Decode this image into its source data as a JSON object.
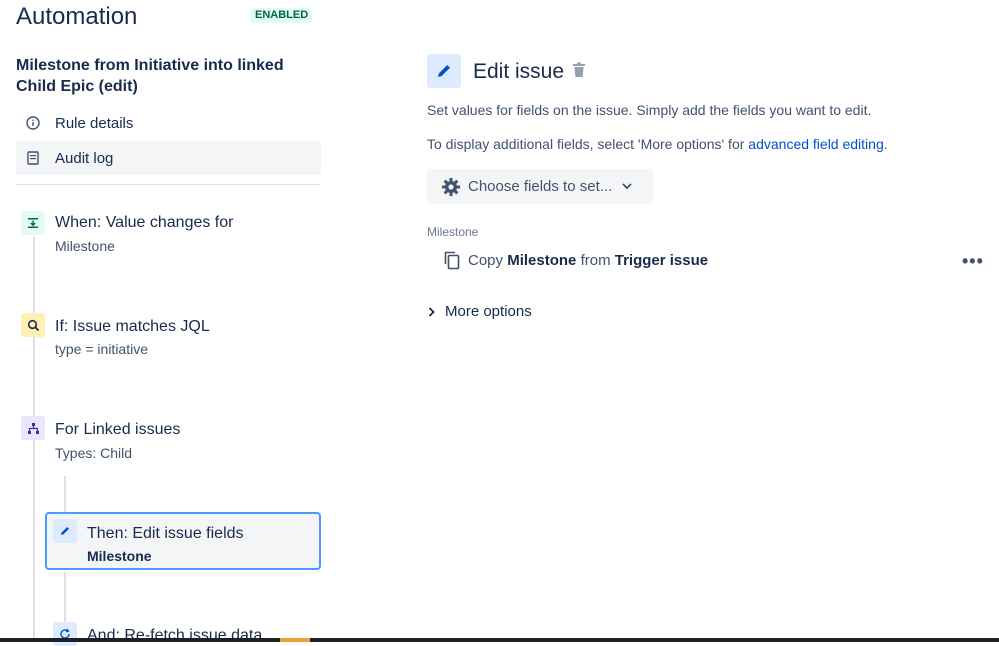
{
  "header": {
    "title": "Automation",
    "status_badge": "ENABLED"
  },
  "rule": {
    "name": "Milestone from Initiative into linked Child Epic (edit)"
  },
  "sidebar": {
    "rule_details_label": "Rule details",
    "audit_log_label": "Audit log"
  },
  "steps": [
    {
      "title": "When: Value changes for",
      "subtitle": "Milestone",
      "icon": "trigger-icon",
      "color": "#e3fcef"
    },
    {
      "title": "If: Issue matches JQL",
      "subtitle": "type = initiative",
      "icon": "search-icon",
      "color": "#fff0b3"
    },
    {
      "title": "For Linked issues",
      "subtitle": "Types: Child",
      "icon": "hierarchy-icon",
      "color": "#eae6ff"
    },
    {
      "title": "Then: Edit issue fields",
      "subtitle": "Milestone",
      "icon": "pencil-icon",
      "color": "#deebff"
    },
    {
      "title": "And: Re-fetch issue data",
      "icon": "refresh-icon",
      "color": "#deebff"
    }
  ],
  "panel": {
    "title": "Edit issue",
    "description": "Set values for fields on the issue. Simply add the fields you want to edit.",
    "more_info_prefix": "To display additional fields, select 'More options' for ",
    "more_info_link": "advanced field editing",
    "more_info_suffix": ".",
    "choose_fields_label": "Choose fields to set...",
    "field_label": "Milestone",
    "copy_row": {
      "copy": "Copy",
      "field": "Milestone",
      "from": "from",
      "source": "Trigger issue"
    },
    "more_options_label": "More options"
  },
  "colors": {
    "accent": "#0052cc",
    "selected_border": "#4c9aff",
    "badge_bg": "#e3fcef",
    "badge_text": "#006644"
  }
}
